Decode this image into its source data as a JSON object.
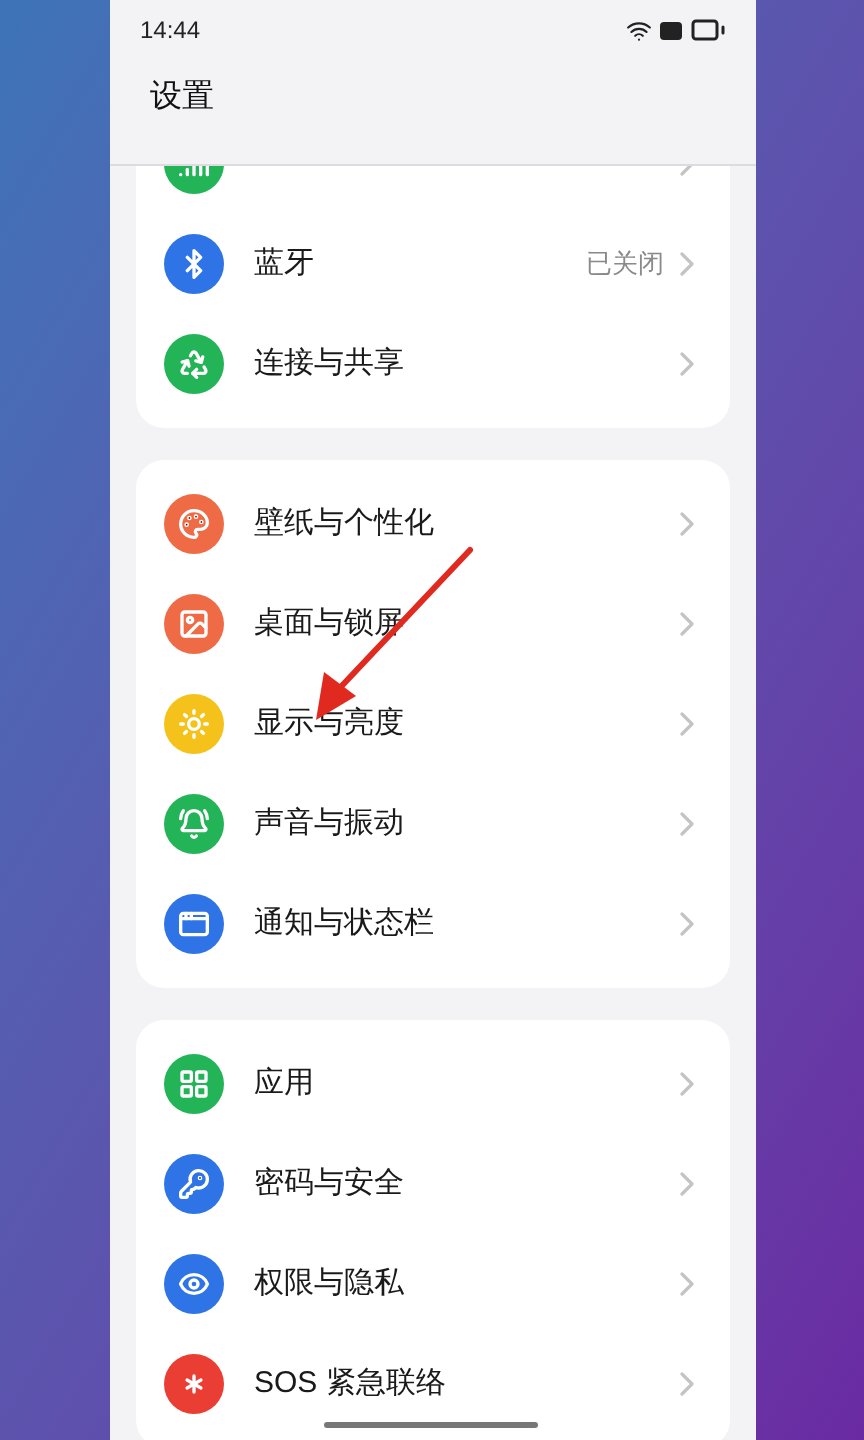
{
  "status_bar": {
    "time": "14:44"
  },
  "header": {
    "title": "设置"
  },
  "groups": [
    {
      "items": [
        {
          "kind": "network",
          "color": "#22b457"
        },
        {
          "kind": "bluetooth",
          "label": "蓝牙",
          "value": "已关闭",
          "color": "#2f74e6"
        },
        {
          "kind": "share",
          "label": "连接与共享",
          "color": "#22b457"
        }
      ]
    },
    {
      "items": [
        {
          "kind": "palette",
          "label": "壁纸与个性化",
          "color": "#ef6b45"
        },
        {
          "kind": "image",
          "label": "桌面与锁屏",
          "color": "#ef6b45"
        },
        {
          "kind": "sun",
          "label": "显示与亮度",
          "color": "#f5c21b"
        },
        {
          "kind": "bell",
          "label": "声音与振动",
          "color": "#22b457"
        },
        {
          "kind": "notification",
          "label": "通知与状态栏",
          "color": "#2f74e6"
        }
      ]
    },
    {
      "items": [
        {
          "kind": "apps",
          "label": "应用",
          "color": "#22b457"
        },
        {
          "kind": "key",
          "label": "密码与安全",
          "color": "#2f74e6"
        },
        {
          "kind": "eye",
          "label": "权限与隐私",
          "color": "#2f74e6"
        },
        {
          "kind": "asterisk",
          "label": "SOS 紧急联络",
          "color": "#ea3d33"
        }
      ]
    }
  ]
}
